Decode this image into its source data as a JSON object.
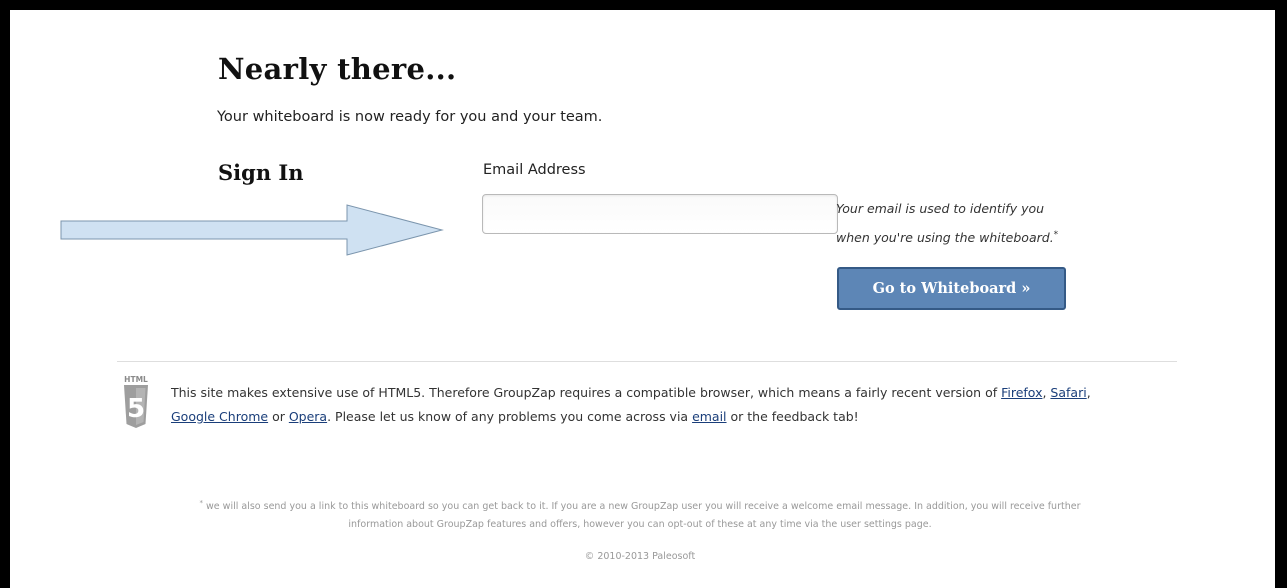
{
  "page": {
    "heading": "Nearly there...",
    "subtitle": "Your whiteboard is now ready for you and your team."
  },
  "signin": {
    "title": "Sign In",
    "email_label": "Email Address",
    "email_value": "",
    "email_placeholder": "",
    "note_line1": "Your email is used to identify you",
    "note_line2": "when you're using the whiteboard.",
    "note_marker": "*",
    "button_label": "Go to Whiteboard »",
    "button_color": "#5d86b6"
  },
  "notice": {
    "badge_label": "HTML",
    "badge_number": "5",
    "text_1": "This site makes extensive use of HTML5. Therefore GroupZap requires a compatible browser, which means a fairly recent version of ",
    "link_firefox": "Firefox",
    "sep_1": ", ",
    "link_safari": "Safari",
    "sep_2": ", ",
    "link_chrome": "Google Chrome",
    "text_or": " or ",
    "link_opera": "Opera",
    "text_2": ". Please let us know of any problems you come across via ",
    "link_email": "email",
    "text_3": " or the feedback tab!"
  },
  "footer": {
    "footnote_marker": "*",
    "footnote_line1": " we will also send you a link to this whiteboard so you can get back to it. If you are a new GroupZap user you will receive a welcome email message. In addition, you will receive further",
    "footnote_line2": "information about GroupZap features and offers, however you can opt-out of these at any time via the user settings page.",
    "copyright": "© 2010-2013 Paleosoft"
  },
  "icons": {
    "arrow": "right-arrow-icon",
    "html5": "html5-badge-icon"
  }
}
